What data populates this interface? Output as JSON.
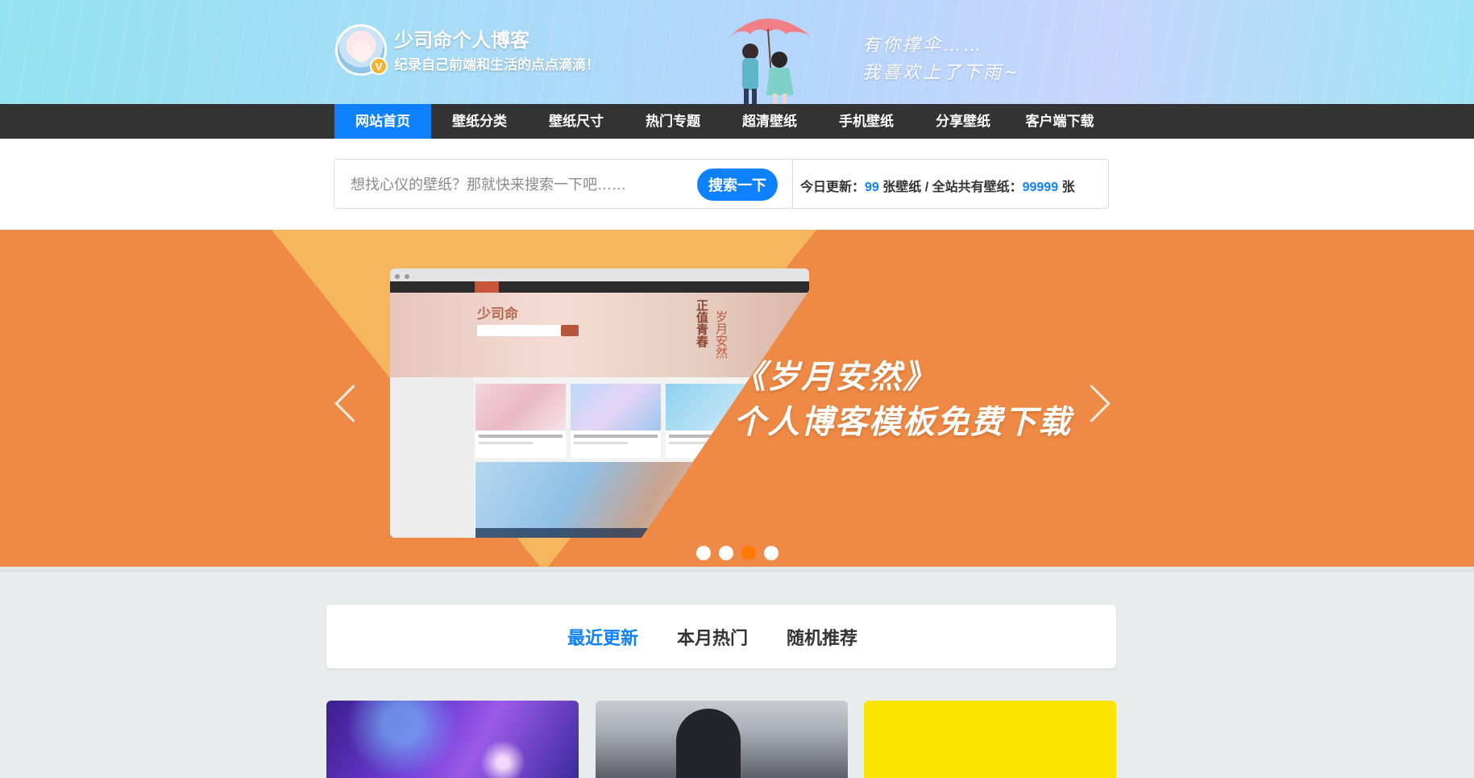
{
  "header": {
    "site_title": "少司命个人博客",
    "site_subtitle": "纪录自己前端和生活的点点滴滴！",
    "avatar_badge": "V",
    "hand_text_line1": "有你撑伞……",
    "hand_text_line2": "我喜欢上了下雨~"
  },
  "nav": {
    "items": [
      "网站首页",
      "壁纸分类",
      "壁纸尺寸",
      "热门专题",
      "超清壁纸",
      "手机壁纸",
      "分享壁纸",
      "客户端下载"
    ],
    "active_index": 0
  },
  "search": {
    "placeholder": "想找心仪的壁纸？那就快来搜索一下吧……",
    "button_label": "搜索一下",
    "stats": {
      "today_label": "今日更新：",
      "today_count": "99",
      "today_unit": "张壁纸 / 全站共有壁纸：",
      "total_count": "99999",
      "total_unit": "张"
    }
  },
  "banner": {
    "title_line1": "《岁月安然》",
    "title_line2": "个人博客模板免费下载",
    "preview_logo": "少司命",
    "preview_vertical_1": "正值青春",
    "preview_vertical_2": "岁月安然",
    "dots": 4,
    "active_dot": 2
  },
  "tabs": {
    "items": [
      "最近更新",
      "本月热门",
      "随机推荐"
    ],
    "active_index": 0
  },
  "colors": {
    "accent": "#0e81ff",
    "nav_bg": "#333333",
    "banner_orange": "#ee8a45",
    "banner_light": "#f5b65d",
    "dot_active": "#ff7a00"
  }
}
